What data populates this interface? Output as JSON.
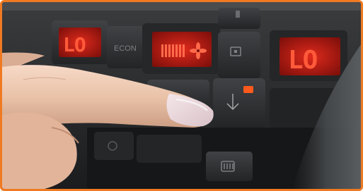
{
  "panel": {
    "left_display": "LO",
    "left_button": "ECON",
    "right_display": "LO",
    "fan_icon": "fan-icon",
    "down_arrow_icon": "arrow-down-icon",
    "rear_defrost_icon": "rear-defrost-icon",
    "indicator_color": "#ff5a1e",
    "display_color": "#d81f16"
  },
  "frame_color": "#f07a22"
}
